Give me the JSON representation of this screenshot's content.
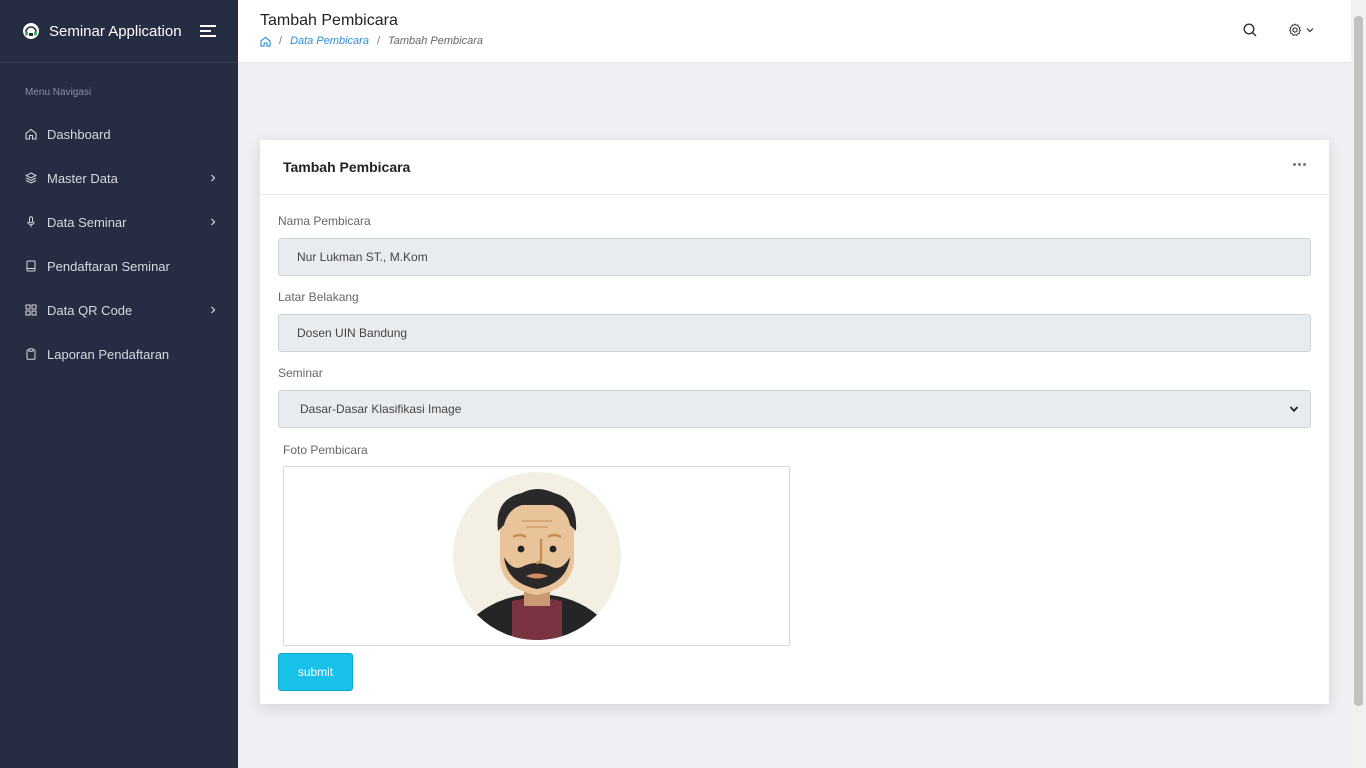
{
  "app": {
    "name": "Seminar Application"
  },
  "sidebar": {
    "menu_heading": "Menu Navigasi",
    "items": [
      {
        "label": "Dashboard",
        "icon": "home-icon",
        "has_children": false
      },
      {
        "label": "Master Data",
        "icon": "layers-icon",
        "has_children": true
      },
      {
        "label": "Data Seminar",
        "icon": "microphone-icon",
        "has_children": true
      },
      {
        "label": "Pendaftaran Seminar",
        "icon": "book-icon",
        "has_children": false
      },
      {
        "label": "Data QR Code",
        "icon": "grid-icon",
        "has_children": true
      },
      {
        "label": "Laporan Pendaftaran",
        "icon": "clipboard-icon",
        "has_children": false
      }
    ]
  },
  "header": {
    "title": "Tambah Pembicara",
    "breadcrumb": {
      "parent": "Data Pembicara",
      "current": "Tambah Pembicara"
    }
  },
  "card": {
    "title": "Tambah Pembicara",
    "fields": {
      "nama": {
        "label": "Nama Pembicara",
        "value": "Nur Lukman ST., M.Kom"
      },
      "latar": {
        "label": "Latar Belakang",
        "value": "Dosen UIN Bandung"
      },
      "seminar": {
        "label": "Seminar",
        "value": "Dasar-Dasar Klasifikasi Image"
      },
      "foto": {
        "label": "Foto Pembicara"
      }
    },
    "submit_label": "submit"
  },
  "colors": {
    "sidebar_bg": "#262c41",
    "accent": "#17c1e8",
    "link": "#2d8fd5"
  }
}
